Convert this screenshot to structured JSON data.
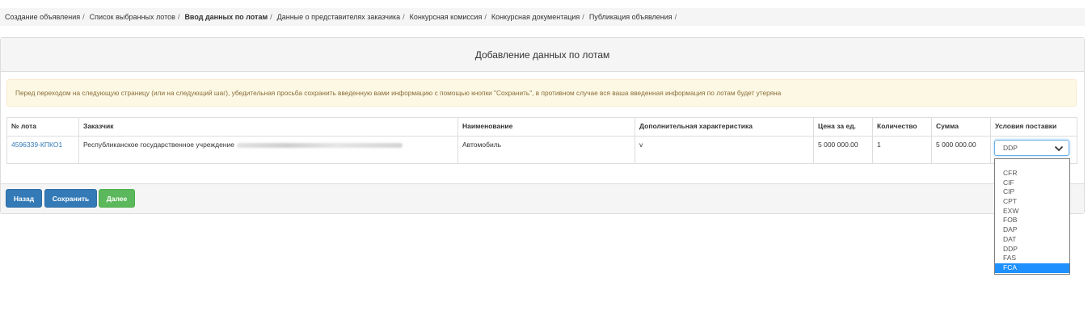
{
  "breadcrumb": [
    {
      "label": "Создание объявления",
      "active": false
    },
    {
      "label": "Список выбранных лотов",
      "active": false
    },
    {
      "label": "Ввод данных по лотам",
      "active": true
    },
    {
      "label": "Данные о представителях заказчика",
      "active": false
    },
    {
      "label": "Конкурсная комиссия",
      "active": false
    },
    {
      "label": "Конкурсная документация",
      "active": false
    },
    {
      "label": "Публикация объявления",
      "active": false
    }
  ],
  "breadcrumb_separator": "/",
  "panel": {
    "title": "Добавление данных по лотам",
    "warning": "Перед переходом на следующую страницу (или на следующий шаг), убедительная просьба сохранить введенную вами информацию с помощью кнопки \"Сохранить\", в противном случае вся ваша введенная информация по лотам будет утеряна"
  },
  "table": {
    "headers": [
      "№ лота",
      "Заказчик",
      "Наименование",
      "Дополнительная характеристика",
      "Цена за ед.",
      "Количество",
      "Сумма",
      "Условия поставки"
    ],
    "rows": [
      {
        "lot_number": "4596339-КПКО1",
        "customer": "Республиканское государственное учреждение",
        "name": "Автомобиль",
        "extra": "v",
        "unit_price": "5 000 000.00",
        "quantity": "1",
        "sum": "5 000 000.00",
        "delivery_terms": "DDP"
      }
    ]
  },
  "delivery_options": [
    "",
    "CFR",
    "CIF",
    "CIP",
    "CPT",
    "EXW",
    "FOB",
    "DAP",
    "DAT",
    "DDP",
    "FAS",
    "FCA"
  ],
  "highlighted_option": "FCA",
  "buttons": {
    "back": "Назад",
    "save": "Сохранить",
    "next": "Далее"
  },
  "colors": {
    "primary": "#337ab7",
    "success": "#5cb85c",
    "warning_bg": "#fcf8e3",
    "warning_text": "#8a6d3b",
    "option_highlight": "#1e90ff"
  }
}
